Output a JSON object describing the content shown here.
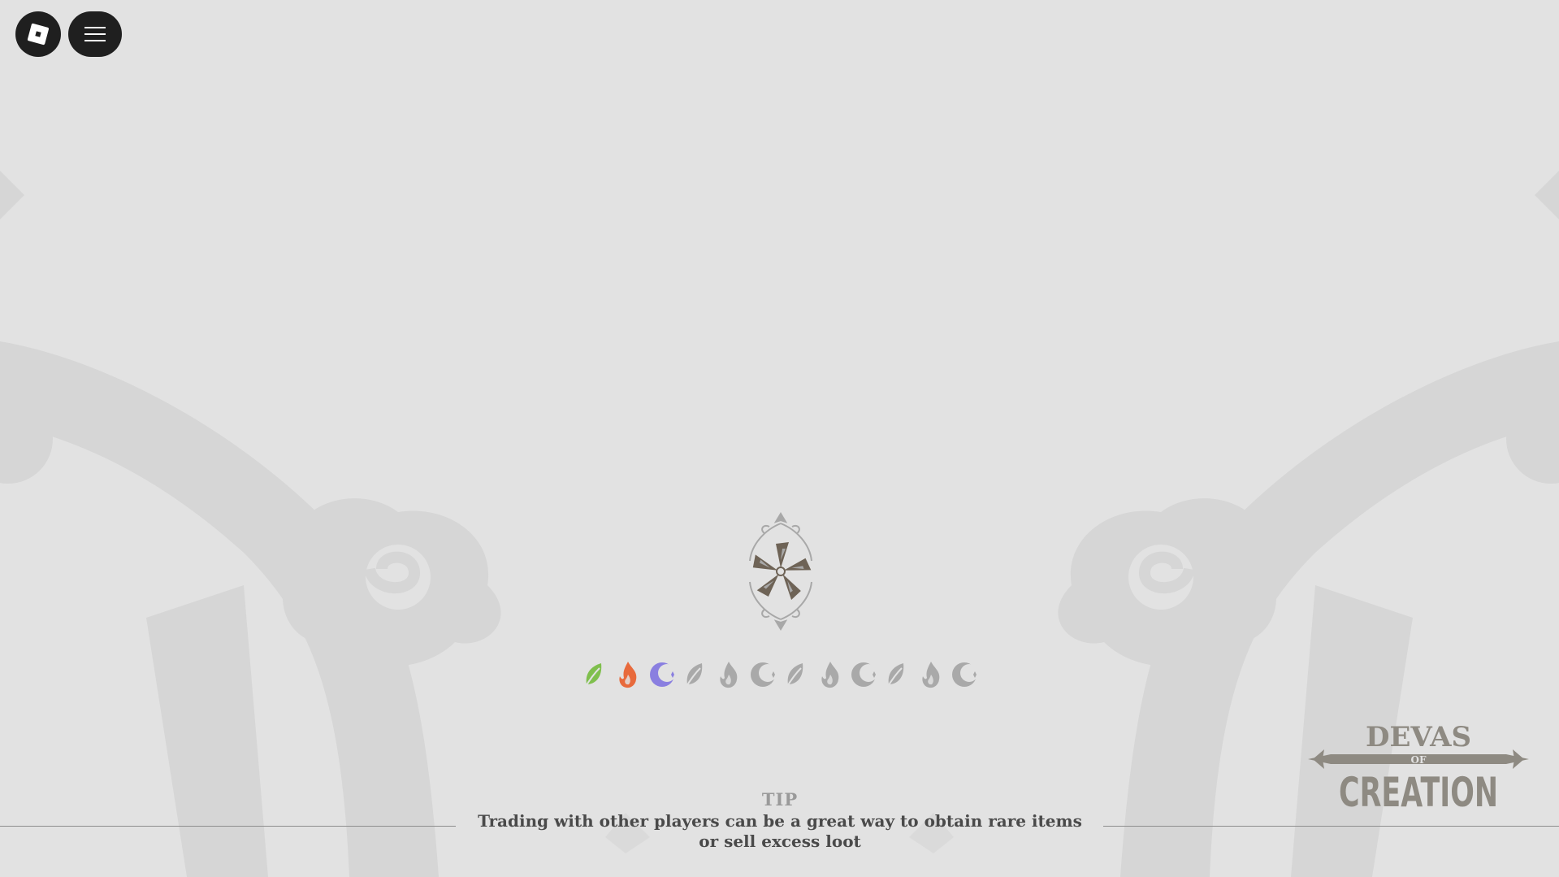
{
  "topbar": {
    "roblox_icon": "roblox-logo-icon",
    "menu_icon": "hamburger-menu-icon",
    "button_color": "#1f1f1f"
  },
  "loading": {
    "spinner_icon": "pinwheel-emblem-icon",
    "element_icons": [
      {
        "icon": "leaf-icon",
        "color": "#7fbf4d",
        "active": true
      },
      {
        "icon": "fire-icon",
        "color": "#e86a3c",
        "active": true
      },
      {
        "icon": "moon-icon",
        "color": "#8a7fe0",
        "active": true
      },
      {
        "icon": "leaf-icon",
        "color": "#a9a9a9",
        "active": false
      },
      {
        "icon": "fire-icon",
        "color": "#a9a9a9",
        "active": false
      },
      {
        "icon": "moon-icon",
        "color": "#a9a9a9",
        "active": false
      },
      {
        "icon": "leaf-icon",
        "color": "#a9a9a9",
        "active": false
      },
      {
        "icon": "fire-icon",
        "color": "#a9a9a9",
        "active": false
      },
      {
        "icon": "moon-icon",
        "color": "#a9a9a9",
        "active": false
      },
      {
        "icon": "leaf-icon",
        "color": "#a9a9a9",
        "active": false
      },
      {
        "icon": "fire-icon",
        "color": "#a9a9a9",
        "active": false
      },
      {
        "icon": "moon-icon",
        "color": "#a9a9a9",
        "active": false
      }
    ]
  },
  "tip": {
    "title": "TIP",
    "text": "Trading with other players can be a great way to obtain rare items or sell excess loot"
  },
  "logo": {
    "line1": "DEVAS",
    "line2": "OF",
    "line3": "CREATION",
    "color": "#8e8a82"
  }
}
